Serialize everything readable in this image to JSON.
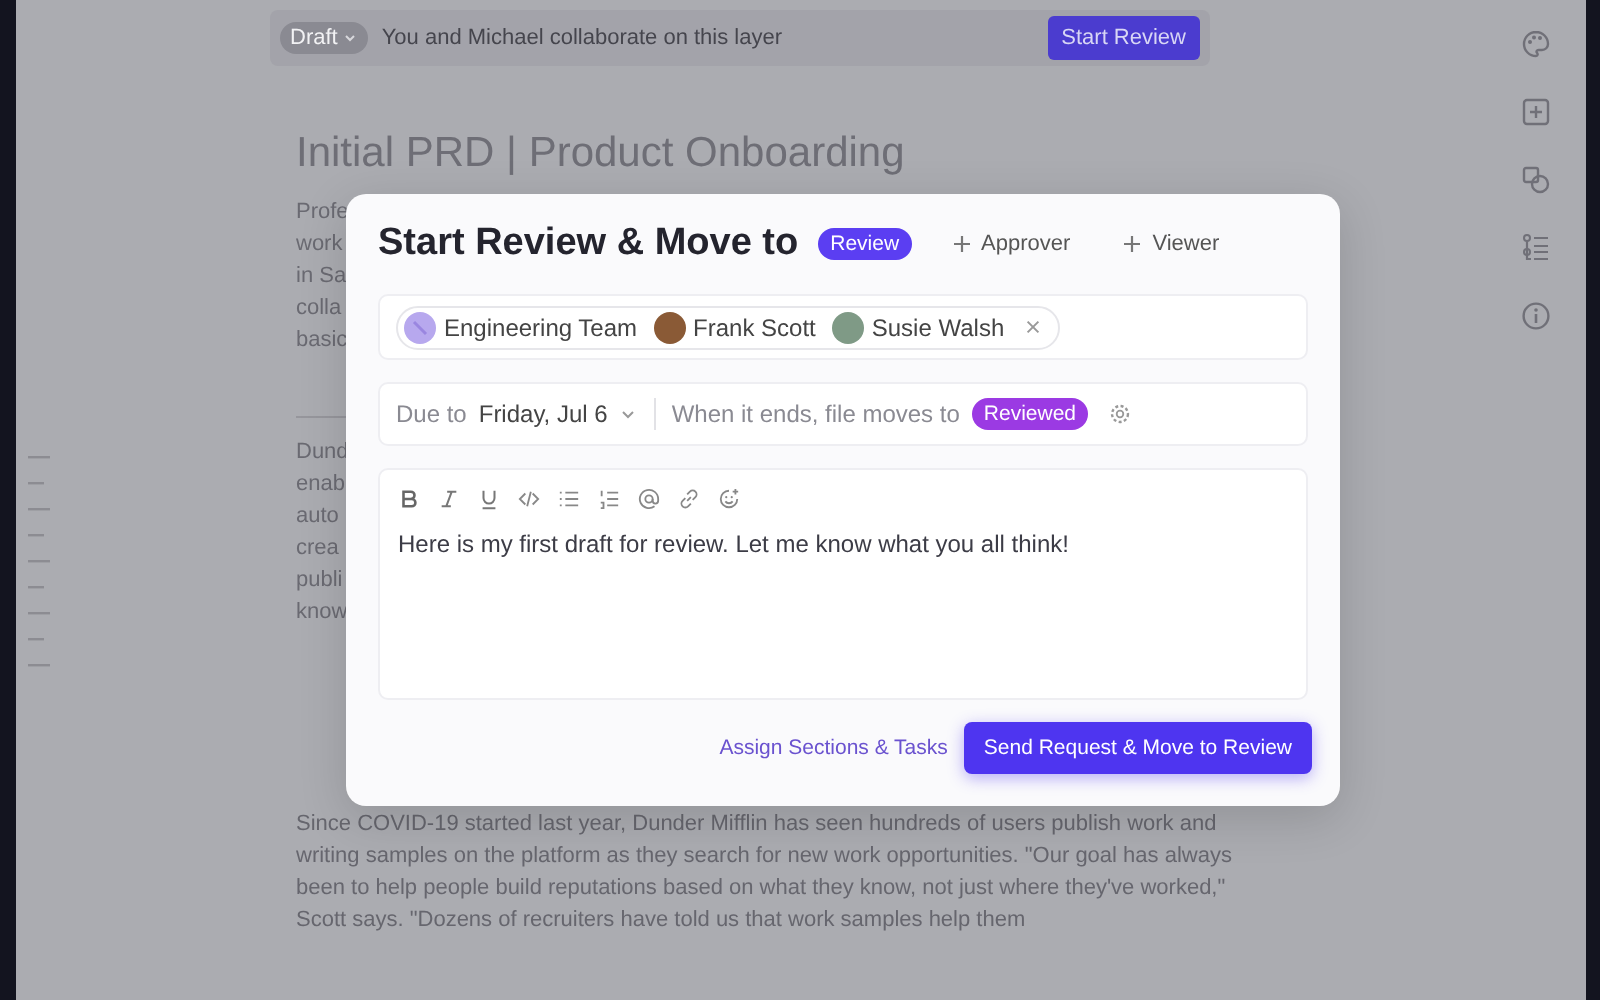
{
  "top_bar": {
    "status": "Draft",
    "message": "You and Michael collaborate on this layer",
    "button": "Start Review"
  },
  "document": {
    "title": "Initial PRD | Product Onboarding",
    "paragraph_1_lines": [
      "Profe",
      "work",
      "in Sa",
      "colla",
      "basic"
    ],
    "paragraph_2_lines": [
      "Dund",
      "enab",
      "auto",
      "crea",
      "publi",
      "know"
    ],
    "paragraph_3": "Since COVID-19 started last year, Dunder Mifflin has seen hundreds of users publish work and writing samples on the platform as they search for new work opportunities. \"Our goal has always been to help people build reputations based on what they know, not just where they've worked,\" Scott says. \"Dozens of recruiters have told us that work samples help them"
  },
  "modal": {
    "title": "Start Review & Move to",
    "stage": "Review",
    "add_actions": [
      {
        "label": "Approver"
      },
      {
        "label": "Viewer"
      }
    ],
    "reviewers": [
      {
        "name": "Engineering Team",
        "kind": "team"
      },
      {
        "name": "Frank Scott",
        "kind": "person",
        "color": "#8a5a36"
      },
      {
        "name": "Susie Walsh",
        "kind": "person",
        "color": "#7f9a86"
      }
    ],
    "due_label": "Due to",
    "due_date": "Friday, Jul 6",
    "end_label": "When it ends, file moves to",
    "end_stage": "Reviewed",
    "message": "Here is my first draft for review. Let me know what you all think!",
    "link": "Assign Sections & Tasks",
    "submit": "Send Request & Move to Review"
  }
}
